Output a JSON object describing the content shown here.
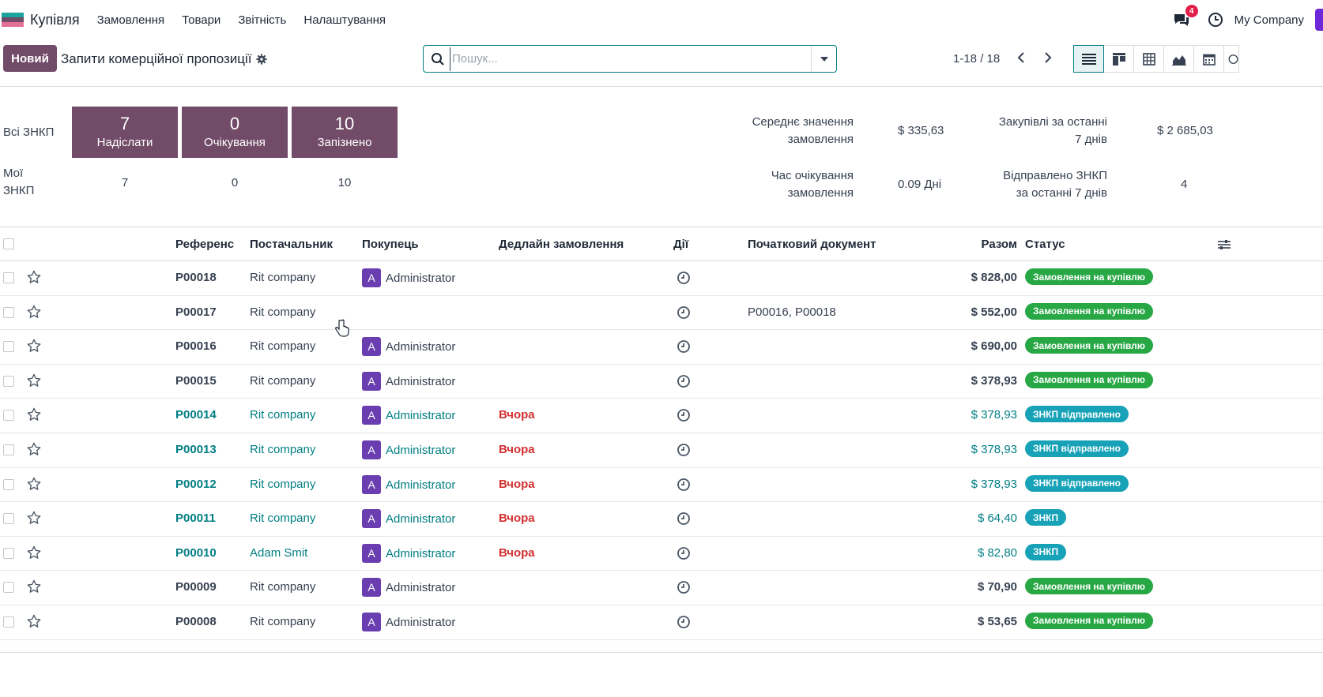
{
  "nav": {
    "app_name": "Купівля",
    "menu": [
      "Замовлення",
      "Товари",
      "Звітність",
      "Налаштування"
    ],
    "notif_count": "4",
    "company": "My Company"
  },
  "control": {
    "new_button": "Новий",
    "title": "Запити комерційної пропозиції",
    "search_placeholder": "Пошук...",
    "pager": "1-18 / 18"
  },
  "dashboard": {
    "all_label": "Всі ЗНКП",
    "my_label_1": "Мої",
    "my_label_2": "ЗНКП",
    "tiles": [
      {
        "num": "7",
        "label": "Надіслати"
      },
      {
        "num": "0",
        "label": "Очікування"
      },
      {
        "num": "10",
        "label": "Запізнено"
      }
    ],
    "my_values": [
      "7",
      "0",
      "10"
    ],
    "stats": {
      "avg_label_1": "Середнє значення",
      "avg_label_2": "замовлення",
      "avg_value": "$ 335,63",
      "purch_label_1": "Закупівлі за останні",
      "purch_label_2": "7 днів",
      "purch_value": "$ 2 685,03",
      "lead_label_1": "Час очікування",
      "lead_label_2": "замовлення",
      "lead_value": "0.09 Дні",
      "sent_label_1": "Відправлено ЗНКП",
      "sent_label_2": "за останні 7 днів",
      "sent_value": "4"
    }
  },
  "table": {
    "headers": {
      "ref": "Референс",
      "vendor": "Постачальник",
      "buyer": "Покупець",
      "deadline": "Дедлайн замовлення",
      "activities": "Дії",
      "origin": "Початковий документ",
      "total": "Разом",
      "status": "Статус"
    },
    "rows": [
      {
        "ref": "P00018",
        "vendor": "Rit company",
        "buyer": "Administrator",
        "deadline": "",
        "origin": "",
        "total": "$ 828,00",
        "status": "Замовлення на купівлю",
        "kind": "po"
      },
      {
        "ref": "P00017",
        "vendor": "Rit company",
        "buyer": "",
        "deadline": "",
        "origin": "P00016, P00018",
        "total": "$ 552,00",
        "status": "Замовлення на купівлю",
        "kind": "po"
      },
      {
        "ref": "P00016",
        "vendor": "Rit company",
        "buyer": "Administrator",
        "deadline": "",
        "origin": "",
        "total": "$ 690,00",
        "status": "Замовлення на купівлю",
        "kind": "po"
      },
      {
        "ref": "P00015",
        "vendor": "Rit company",
        "buyer": "Administrator",
        "deadline": "",
        "origin": "",
        "total": "$ 378,93",
        "status": "Замовлення на купівлю",
        "kind": "po"
      },
      {
        "ref": "P00014",
        "vendor": "Rit company",
        "buyer": "Administrator",
        "deadline": "Вчора",
        "origin": "",
        "total": "$ 378,93",
        "status": "ЗНКП відправлено",
        "kind": "sent"
      },
      {
        "ref": "P00013",
        "vendor": "Rit company",
        "buyer": "Administrator",
        "deadline": "Вчора",
        "origin": "",
        "total": "$ 378,93",
        "status": "ЗНКП відправлено",
        "kind": "sent"
      },
      {
        "ref": "P00012",
        "vendor": "Rit company",
        "buyer": "Administrator",
        "deadline": "Вчора",
        "origin": "",
        "total": "$ 378,93",
        "status": "ЗНКП відправлено",
        "kind": "sent"
      },
      {
        "ref": "P00011",
        "vendor": "Rit company",
        "buyer": "Administrator",
        "deadline": "Вчора",
        "origin": "",
        "total": "$ 64,40",
        "status": "ЗНКП",
        "kind": "sent"
      },
      {
        "ref": "P00010",
        "vendor": "Adam Smit",
        "buyer": "Administrator",
        "deadline": "Вчора",
        "origin": "",
        "total": "$ 82,80",
        "status": "ЗНКП",
        "kind": "sent"
      },
      {
        "ref": "P00009",
        "vendor": "Rit company",
        "buyer": "Administrator",
        "deadline": "",
        "origin": "",
        "total": "$ 70,90",
        "status": "Замовлення на купівлю",
        "kind": "po"
      },
      {
        "ref": "P00008",
        "vendor": "Rit company",
        "buyer": "Administrator",
        "deadline": "",
        "origin": "",
        "total": "$ 53,65",
        "status": "Замовлення на купівлю",
        "kind": "po"
      }
    ]
  },
  "colors": {
    "brand": "#714b67",
    "accent": "#017e84",
    "po_badge": "#28a745",
    "rfq_badge": "#17a2b8",
    "deadline": "#d32f2f"
  }
}
